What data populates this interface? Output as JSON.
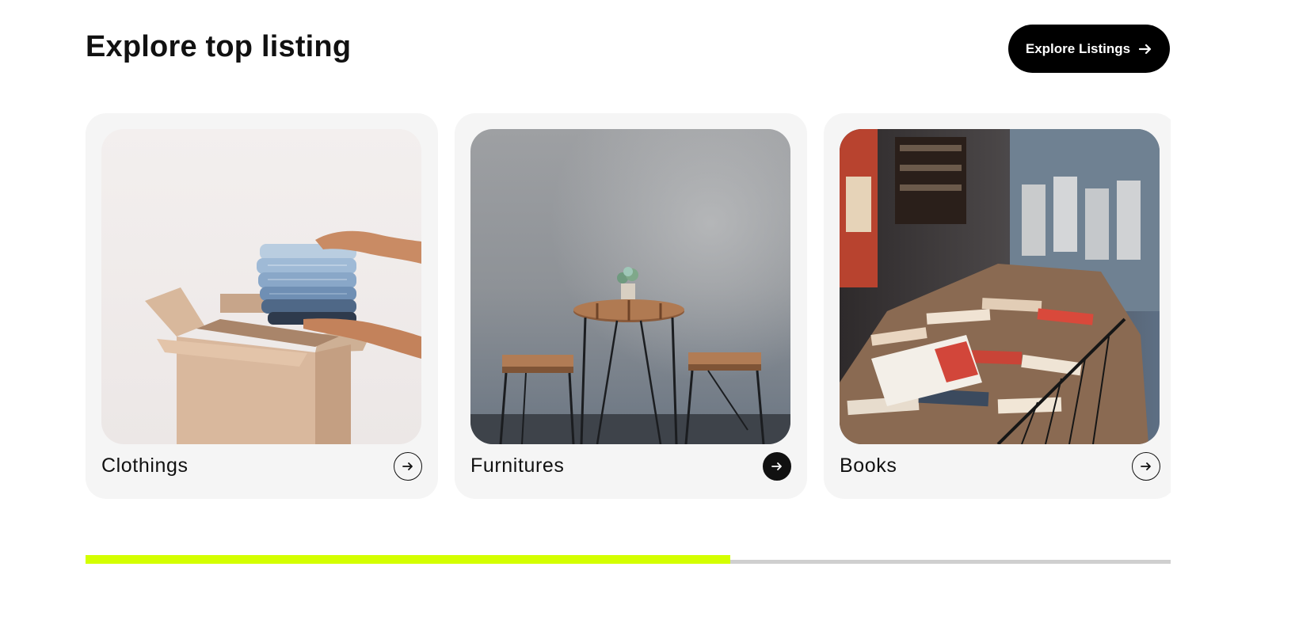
{
  "section": {
    "title": "Explore top listing",
    "cta_label": "Explore Listings"
  },
  "cards": [
    {
      "label": "Clothings",
      "image": "clothes-box-photo",
      "arrow_style": "outline"
    },
    {
      "label": "Furnitures",
      "image": "table-stools-photo",
      "arrow_style": "filled"
    },
    {
      "label": "Books",
      "image": "book-pile-photo",
      "arrow_style": "outline"
    }
  ],
  "carousel_progress": {
    "value": 0.594
  },
  "colors": {
    "accent": "#d4ff00",
    "button_bg": "#000000",
    "card_bg": "#f5f5f5",
    "track": "#cfcfcf"
  }
}
